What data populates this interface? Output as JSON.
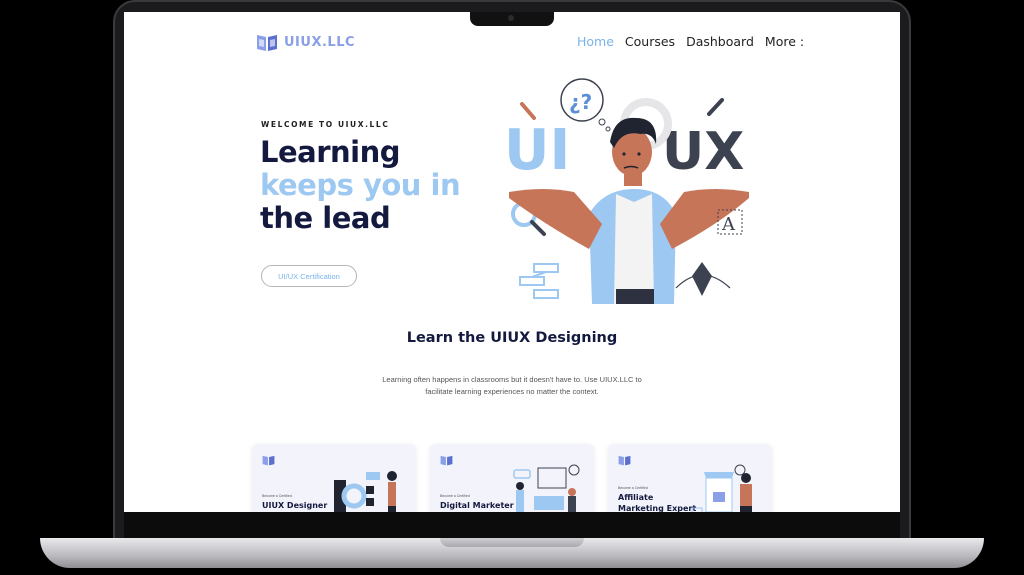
{
  "brand": {
    "name": "UIUX.LLC",
    "accent": "#8a9fe8"
  },
  "nav": {
    "items": [
      {
        "label": "Home",
        "active": true
      },
      {
        "label": "Courses"
      },
      {
        "label": "Dashboard"
      },
      {
        "label": "More :"
      }
    ],
    "active_color": "#7ab3ea"
  },
  "hero": {
    "eyebrow": "WELCOME TO UIUX.LLC",
    "headline_line1": "Learning",
    "headline_line2": "keeps you in",
    "headline_line3": "the lead",
    "cta_label": "UI/UX Certification",
    "illustration": {
      "left_text": "UI",
      "right_text": "UX",
      "question_bubble": "¿?",
      "icon_letter": "A"
    }
  },
  "section": {
    "title": "Learn the UIUX Designing",
    "description": "Learning often happens in classrooms but it doesn't have to. Use UIUX.LLC to facilitate learning experiences no matter the context."
  },
  "cards": [
    {
      "small": "Become a Certified",
      "title": "UIUX Designer"
    },
    {
      "small": "Become a Certified",
      "title": "Digital Marketer"
    },
    {
      "small": "Become a Certified",
      "title": "Affiliate Marketing Expert"
    }
  ],
  "colors": {
    "dark_navy": "#141a3f",
    "light_blue": "#9cc8f1",
    "skin": "#c77558"
  }
}
